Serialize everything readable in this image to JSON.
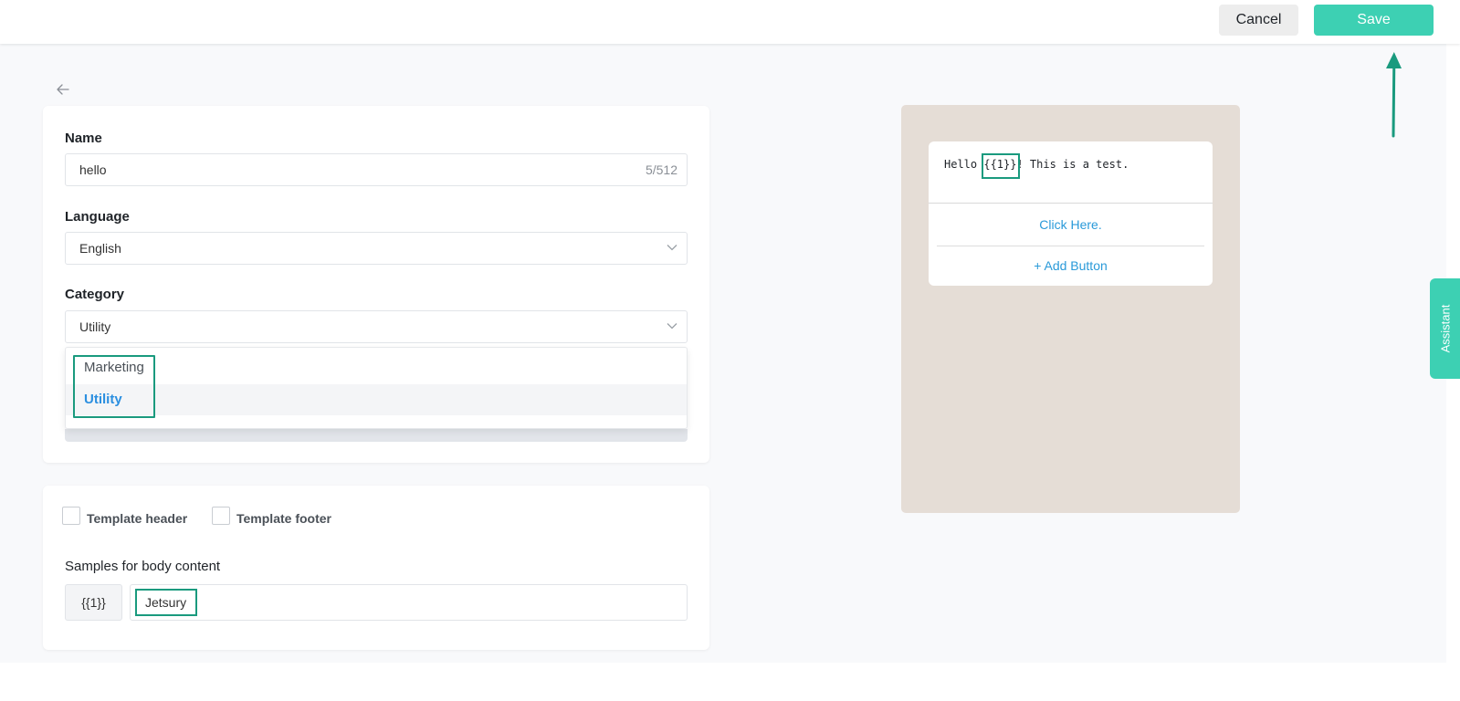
{
  "toolbar": {
    "cancel_label": "Cancel",
    "save_label": "Save"
  },
  "form": {
    "name_label": "Name",
    "name_value": "hello",
    "name_counter": "5/512",
    "language_label": "Language",
    "language_value": "English",
    "category_label": "Category",
    "category_value": "Utility",
    "category_options": [
      "Marketing",
      "Utility"
    ]
  },
  "options": {
    "header_label": "Template header",
    "footer_label": "Template footer",
    "samples_label": "Samples for body content",
    "variable": "{{1}}",
    "sample_value": "Jetsury"
  },
  "preview": {
    "text_prefix": "Hello ",
    "text_var": "{{1}}",
    "text_suffix": "! This is a test.",
    "button_label": "Click Here.",
    "add_button_label": "+ Add Button"
  },
  "assistant": {
    "label": "Assistant"
  },
  "colors": {
    "accent": "#3dd0b3",
    "highlight": "#1a9a7e",
    "link": "#2a9ad9"
  }
}
